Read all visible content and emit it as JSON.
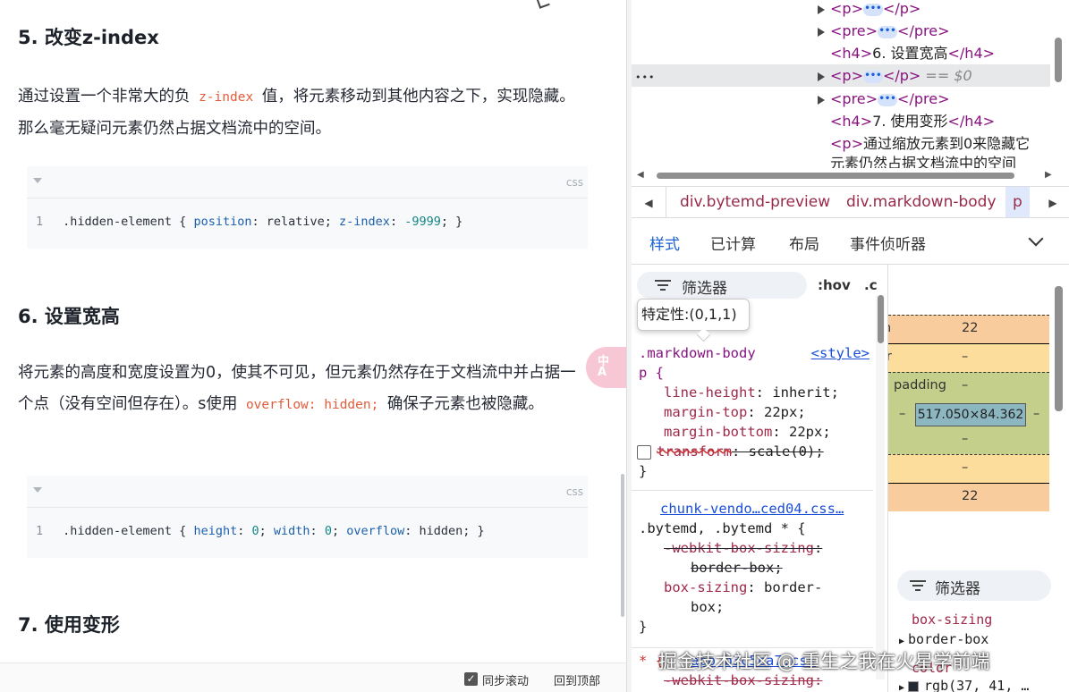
{
  "article": {
    "section5": {
      "heading": "5. 改变z-index",
      "text_before": "通过设置一个非常大的负 ",
      "inline_code": "z-index",
      "text_after": " 值，将元素移动到其他内容之下，实现隐藏。那么毫无疑问元素仍然占据文档流中的空间。",
      "code_lang": "css",
      "code_line_no": "1",
      "code": {
        "selector": ".hidden-element { ",
        "p1": "position",
        "v1": ": relative; ",
        "p2": "z-index",
        "v2a": ": ",
        "v2num": "-9999",
        "v2b": "; }"
      }
    },
    "section6": {
      "heading": "6. 设置宽高",
      "text_before": "将元素的高度和宽度设置为0，使其不可见，但元素仍然存在于文档流中并占据一个点（没有空间但存在）。s使用 ",
      "inline_code": "overflow: hidden;",
      "text_after": " 确保子元素也被隐藏。",
      "code_lang": "css",
      "code_line_no": "1",
      "code": {
        "selector": ".hidden-element { ",
        "p1": "height",
        "v1a": ": ",
        "v1num": "0",
        "v1b": "; ",
        "p2": "width",
        "v2a": ": ",
        "v2num": "0",
        "v2b": "; ",
        "p3": "overflow",
        "v3": ": hidden; }"
      }
    },
    "section7": {
      "heading": "7. 使用变形"
    },
    "translate_badge": "中\nA",
    "bottom_bar": {
      "sync_label": "同步滚动",
      "top_link": "回到顶部"
    }
  },
  "devtools": {
    "dom_rows": [
      {
        "open": "<p>",
        "close": "</p>"
      },
      {
        "open": "<pre>",
        "close": "</pre>"
      },
      {
        "open": "<h4>",
        "text": "6. 设置宽高",
        "close": "</h4>"
      },
      {
        "open": "<p>",
        "close": "</p>",
        "suffix": " == $0",
        "dots": "•••"
      },
      {
        "open": "<pre>",
        "close": "</pre>"
      },
      {
        "open": "<h4>",
        "text": "7. 使用变形",
        "close": "</h4>"
      },
      {
        "open": "<p>",
        "text": "通过缩放元素到0来隐藏它"
      },
      {
        "text": "元素仍然占据文档流中的空间"
      }
    ],
    "ellipsis": "•••",
    "breadcrumb": [
      "div.bytemd-preview",
      "div.markdown-body",
      "p"
    ],
    "tabs": [
      "样式",
      "已计算",
      "布局",
      "事件侦听器"
    ],
    "styles": {
      "filter_placeholder": "筛选器",
      "hov": ":hov",
      "cls": ".c",
      "tooltip": "特定性:(0,1,1)",
      "rule1": {
        "selector_a": ".markdown-body",
        "selector_b": "p {",
        "source": "<style>",
        "decls": [
          {
            "prop": "line-height",
            "val": ": inherit;"
          },
          {
            "prop": "margin-top",
            "val": ": 22px;"
          },
          {
            "prop": "margin-bottom",
            "val": ": 22px;"
          },
          {
            "prop": "transform",
            "val": ": scale(0);"
          }
        ],
        "close": "}"
      },
      "rule2": {
        "source": "chunk-vendo…ced04.css…",
        "selector": ".bytemd, .bytemd * {",
        "decls": [
          {
            "prop": "-webkit-box-sizing",
            "val": ":"
          },
          {
            "prop": "",
            "val": "border-box;"
          },
          {
            "prop": "box-sizing",
            "val": ": border-"
          },
          {
            "prop": "",
            "val": "box;"
          }
        ],
        "close": "}"
      },
      "rule3": {
        "selector": "* {",
        "source": "app.b3c5ca7.css",
        "decl": "-webkit-box-sizing:"
      }
    },
    "box_model": {
      "margin_label": "margin",
      "margin_top": "22",
      "border_label": "border",
      "border_val": "–",
      "padding_label": "padding",
      "padding_val": "–",
      "content": "517.050×84.362",
      "side_left": "–",
      "side_right": "–",
      "padding_bottom": "–",
      "border_bottom": "–",
      "margin_bottom": "22"
    },
    "computed": {
      "filter_placeholder": "筛选器",
      "rows": [
        {
          "prop": "box-sizing",
          "val": "border-box"
        },
        {
          "prop": "color",
          "val": "rgb(37, 41, …"
        }
      ]
    }
  },
  "watermark": "掘金技术社区 @ 重生之我在火星学前端"
}
